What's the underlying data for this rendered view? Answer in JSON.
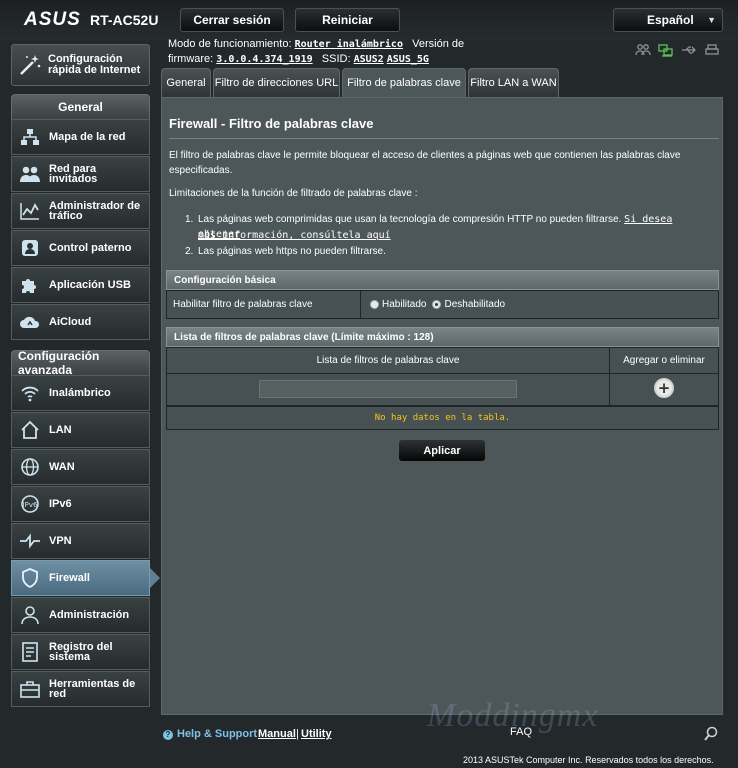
{
  "header": {
    "brand": "ASUS",
    "model": "RT-AC52U",
    "logout_label": "Cerrar sesión",
    "reboot_label": "Reiniciar",
    "language": "Español"
  },
  "info": {
    "mode_label": "Modo de funcionamiento:",
    "mode_value": "Router inalámbrico",
    "version_label": "Versión de",
    "firmware_label": "firmware:",
    "firmware_value": "3.0.0.4.374_1919",
    "ssid_label": "SSID:",
    "ssid_1": "ASUS2",
    "ssid_2": "ASUS_5G"
  },
  "quick_setup": {
    "line1": "Configuración",
    "line2": "rápida de Internet"
  },
  "sidebar": {
    "general_title": "General",
    "general_items": [
      {
        "line1": "Mapa de la red",
        "line2": ""
      },
      {
        "line1": "Red para",
        "line2": "invitados"
      },
      {
        "line1": "Administrador de",
        "line2": "tráfico"
      },
      {
        "line1": "Control paterno",
        "line2": ""
      },
      {
        "line1": "Aplicación USB",
        "line2": ""
      },
      {
        "line1": "AiCloud",
        "line2": ""
      }
    ],
    "advanced_title": "Configuración avanzada",
    "advanced_items": [
      {
        "line1": "Inalámbrico",
        "line2": ""
      },
      {
        "line1": "LAN",
        "line2": ""
      },
      {
        "line1": "WAN",
        "line2": ""
      },
      {
        "line1": "IPv6",
        "line2": ""
      },
      {
        "line1": "VPN",
        "line2": ""
      },
      {
        "line1": "Firewall",
        "line2": ""
      },
      {
        "line1": "Administración",
        "line2": ""
      },
      {
        "line1": "Registro del",
        "line2": "sistema"
      },
      {
        "line1": "Herramientas de",
        "line2": "red"
      }
    ]
  },
  "tabs": [
    {
      "label": "General"
    },
    {
      "label": "Filtro de direcciones URL"
    },
    {
      "label": "Filtro de palabras clave"
    },
    {
      "label": "Filtro LAN a WAN"
    }
  ],
  "content": {
    "title": "Firewall - Filtro de palabras clave",
    "description": "El filtro de palabras clave le permite bloquear el acceso de clientes a páginas web que contienen las palabras clave especificadas.",
    "limitations_title": "Limitaciones de la función de filtrado de palabras clave :",
    "limitation_1_text": "Las páginas web comprimidas que usan la tecnología de compresión HTTP no pueden filtrarse.",
    "limitation_1_link_a": "Si desea obtener",
    "limitation_1_link_b": "más información, consúltela aquí",
    "limitation_2_text": "Las páginas web https no pueden filtrarse.",
    "basic_config_title": "Configuración básica",
    "enable_label": "Habilitar filtro de palabras clave",
    "enabled_option": "Habilitado",
    "disabled_option": "Deshabilitado",
    "list_title": "Lista de filtros de palabras clave (Límite máximo : 128)",
    "list_column": "Lista de filtros de palabras clave",
    "action_column": "Agregar o eliminar",
    "keyword_value": "",
    "empty_message": "No hay datos en la tabla.",
    "apply_label": "Aplicar"
  },
  "footer": {
    "help": "Help & Support",
    "manual": "Manual",
    "separator": "|",
    "utility": "Utility",
    "faq": "FAQ",
    "watermark": "Moddingmx",
    "copyright": "2013 ASUSTek Computer Inc. Reservados todos los derechos."
  }
}
